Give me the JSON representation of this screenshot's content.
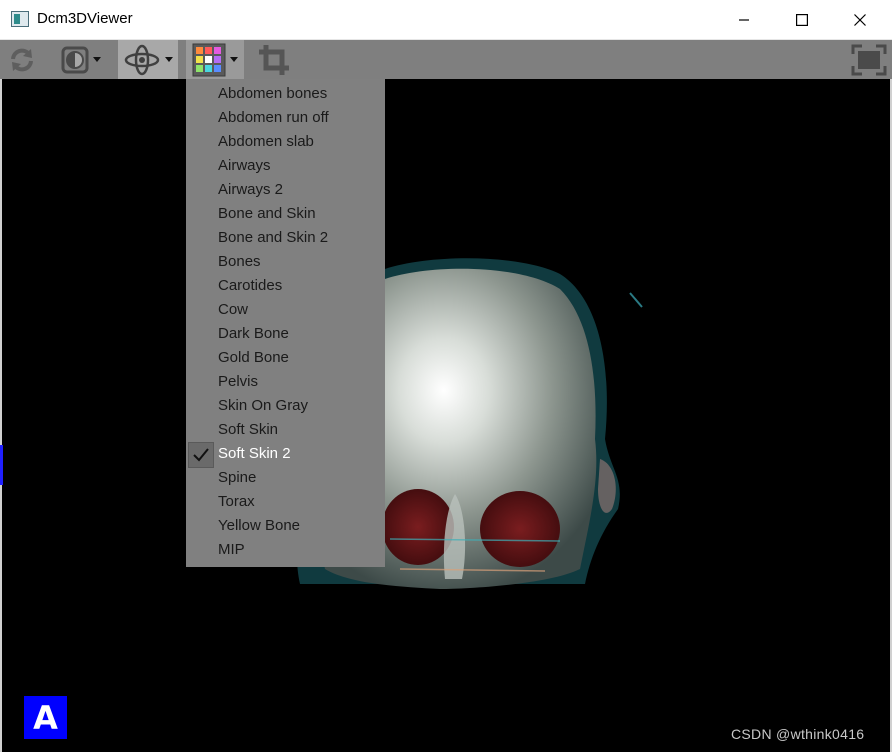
{
  "window": {
    "title": "Dcm3DViewer",
    "minimize_icon": "minimize-icon",
    "maximize_icon": "maximize-icon",
    "close_icon": "close-icon"
  },
  "toolbar": {
    "buttons": [
      {
        "name": "reset-view",
        "icon": "refresh-icon"
      },
      {
        "name": "window-level",
        "icon": "contrast-icon",
        "has_dropdown": true
      },
      {
        "name": "rotate-3d",
        "icon": "orbit-rotate-icon",
        "has_dropdown": true,
        "state": "active"
      },
      {
        "name": "color-preset",
        "icon": "color-grid-icon",
        "has_dropdown": true,
        "state": "selected"
      },
      {
        "name": "crop",
        "icon": "crop-icon"
      },
      {
        "name": "fullscreen",
        "icon": "fullscreen-icon"
      }
    ]
  },
  "preset_menu": {
    "items": [
      {
        "label": "Abdomen bones",
        "checked": false
      },
      {
        "label": "Abdomen run off",
        "checked": false
      },
      {
        "label": "Abdomen slab",
        "checked": false
      },
      {
        "label": "Airways",
        "checked": false
      },
      {
        "label": "Airways 2",
        "checked": false
      },
      {
        "label": "Bone and Skin",
        "checked": false
      },
      {
        "label": "Bone and Skin 2",
        "checked": false
      },
      {
        "label": "Bones",
        "checked": false
      },
      {
        "label": "Carotides",
        "checked": false
      },
      {
        "label": "Cow",
        "checked": false
      },
      {
        "label": "Dark Bone",
        "checked": false
      },
      {
        "label": "Gold Bone",
        "checked": false
      },
      {
        "label": "Pelvis",
        "checked": false
      },
      {
        "label": "Skin On Gray",
        "checked": false
      },
      {
        "label": "Soft Skin",
        "checked": false
      },
      {
        "label": "Soft Skin 2",
        "checked": true
      },
      {
        "label": "Spine",
        "checked": false
      },
      {
        "label": "Torax",
        "checked": false
      },
      {
        "label": "Yellow Bone",
        "checked": false
      },
      {
        "label": "MIP",
        "checked": false
      }
    ]
  },
  "viewport": {
    "orientation_label": "A",
    "orientation_color": "#0000ff",
    "watermark": "CSDN @wthink0416"
  },
  "colors": {
    "toolbar_bg": "#7f7f7f",
    "menu_bg": "#808080",
    "viewport_bg": "#000000"
  }
}
